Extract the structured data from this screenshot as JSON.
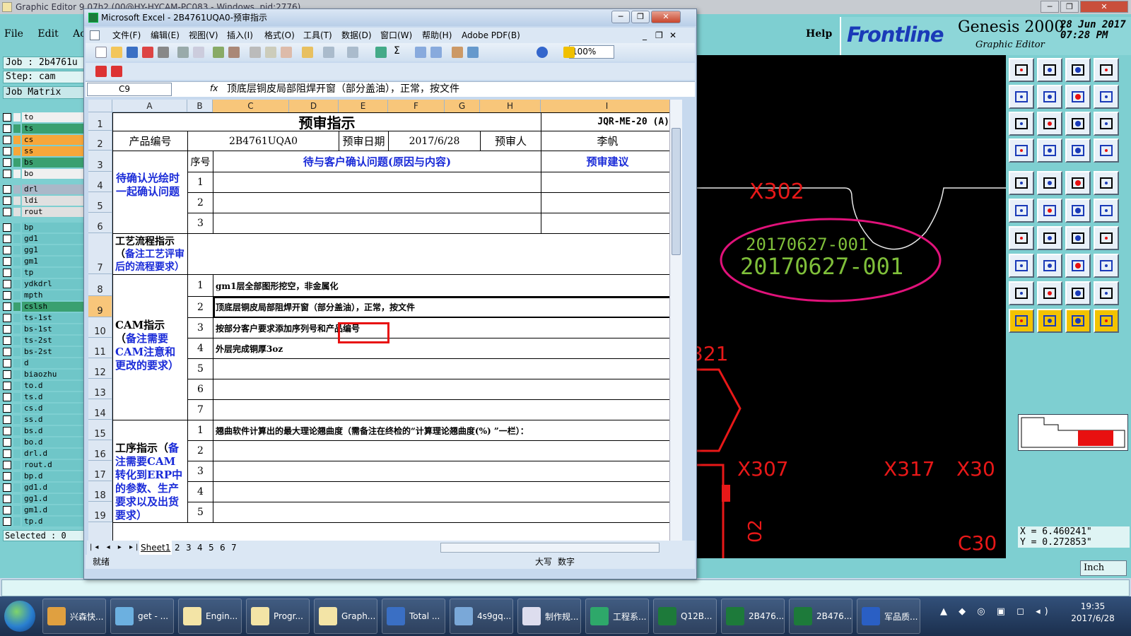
{
  "genesis": {
    "window_title": "Graphic Editor 9.07h2 (00@HY-HYCAM-PC083 - Windows, pid:2776)",
    "menu": [
      "File",
      "Edit",
      "Act"
    ],
    "help": "Help",
    "brand_logo": "Frontline",
    "brand_product": "Genesis 2000",
    "brand_sub": "Graphic Editor",
    "date": "28 Jun 2017",
    "time": "07:28 PM",
    "job_label": "Job : 2b4761u",
    "step_label": "Step: cam",
    "job_matrix": "Job Matrix",
    "layers_group1": [
      {
        "name": "to",
        "color": "#f0f0f0"
      },
      {
        "name": "ts",
        "color": "#3aa070"
      },
      {
        "name": "cs",
        "color": "#f7a73a"
      },
      {
        "name": "ss",
        "color": "#f7a73a"
      },
      {
        "name": "bs",
        "color": "#3aa070"
      },
      {
        "name": "bo",
        "color": "#f0f0f0"
      }
    ],
    "layers_group2": [
      {
        "name": "drl",
        "color": "#aab8c8"
      },
      {
        "name": "ldi",
        "color": "#e0e0e0"
      },
      {
        "name": "rout",
        "color": "#e0e0e0"
      }
    ],
    "layers_group3": [
      "bp",
      "gd1",
      "gg1",
      "gm1",
      "tp",
      "ydkdrl",
      "mpth",
      "cslsh",
      "ts-1st",
      "bs-1st",
      "ts-2st",
      "bs-2st",
      "d",
      "biaozhu",
      "to.d",
      "ts.d",
      "cs.d",
      "ss.d",
      "bs.d",
      "bo.d",
      "drl.d",
      "rout.d",
      "bp.d",
      "gd1.d",
      "gg1.d",
      "gm1.d",
      "tp.d"
    ],
    "selected": "Selected : 0",
    "canvas_labels": [
      "X302",
      "20170627-001",
      "20170627-001",
      "321",
      "X307",
      "X317",
      "X30",
      "02",
      "C30"
    ],
    "coord_x": "X = 6.460241\"",
    "coord_y": "Y = 0.272853\"",
    "units": "Inch"
  },
  "excel": {
    "title": "Microsoft Excel - 2B4761UQA0-预审指示",
    "menu": [
      "文件(F)",
      "编辑(E)",
      "视图(V)",
      "插入(I)",
      "格式(O)",
      "工具(T)",
      "数据(D)",
      "窗口(W)",
      "帮助(H)",
      "Adobe PDF(B)"
    ],
    "zoom": "100%",
    "name_box": "C9",
    "fx": "fx",
    "formula": "顶底层铜皮局部阻焊开窗（部分盖油），正常，按文件",
    "columns": [
      "A",
      "B",
      "C",
      "D",
      "E",
      "F",
      "G",
      "H",
      "I"
    ],
    "rows": [
      "1",
      "2",
      "3",
      "4",
      "5",
      "6",
      "7",
      "8",
      "9",
      "10",
      "11",
      "12",
      "13",
      "14",
      "15",
      "16",
      "17",
      "18",
      "19"
    ],
    "sheet": {
      "title": "预审指示",
      "doc_code": "JQR-ME-20 (A)",
      "product_no_label": "产品编号",
      "product_no": "2B4761UQA0",
      "review_date_label": "预审日期",
      "review_date": "2017/6/28",
      "reviewer_label": "预审人",
      "reviewer": "李帆",
      "seq_label": "序号",
      "confirm_header": "待与客户确认问题(原因与内容)",
      "suggest_header": "预审建议",
      "confirm_group": "待确认光绘时一起确认问题",
      "confirm_seq": [
        "1",
        "2",
        "3"
      ],
      "process_label_1": "工艺流程指示（",
      "process_label_2": "备注工艺评审后的流程要求）",
      "cam_label_1": "CAM指示（",
      "cam_label_2": "备注需要CAM注意和更改的要求）",
      "cam_seq": [
        "1",
        "2",
        "3",
        "4",
        "5",
        "6",
        "7"
      ],
      "cam_items": [
        "gm1层全部图形挖空，非金属化",
        "顶底层铜皮局部阻焊开窗（部分盖油），正常，按文件",
        "按部分客户要求添加序列号和产品编号",
        "外层完成铜厚3oz",
        "",
        "",
        ""
      ],
      "proc_label_1": "工序指示（",
      "proc_label_2": "备注需要CAM转化到ERP中的参数、生产要求以及出货要求）",
      "proc_seq": [
        "1",
        "2",
        "3",
        "4",
        "5"
      ],
      "proc_items": [
        "翘曲软件计算出的最大理论翘曲度（需备注在终检的“计算理论翘曲度(%) ”一栏）：",
        "",
        "",
        "",
        ""
      ]
    },
    "sheet_tabs": [
      "Sheet1",
      "2",
      "3",
      "4",
      "5",
      "6",
      "7"
    ],
    "status": "就绪",
    "status_caps": "大写",
    "status_num": "数字"
  },
  "taskbar": {
    "items": [
      "兴森快...",
      "get - ...",
      "Engin...",
      "Progr...",
      "Graph...",
      "Total ...",
      "4s9gq...",
      "制作规...",
      "工程系...",
      "Q12B...",
      "2B476...",
      "2B476...",
      "军品质..."
    ],
    "time": "19:35",
    "date": "2017/6/28"
  }
}
